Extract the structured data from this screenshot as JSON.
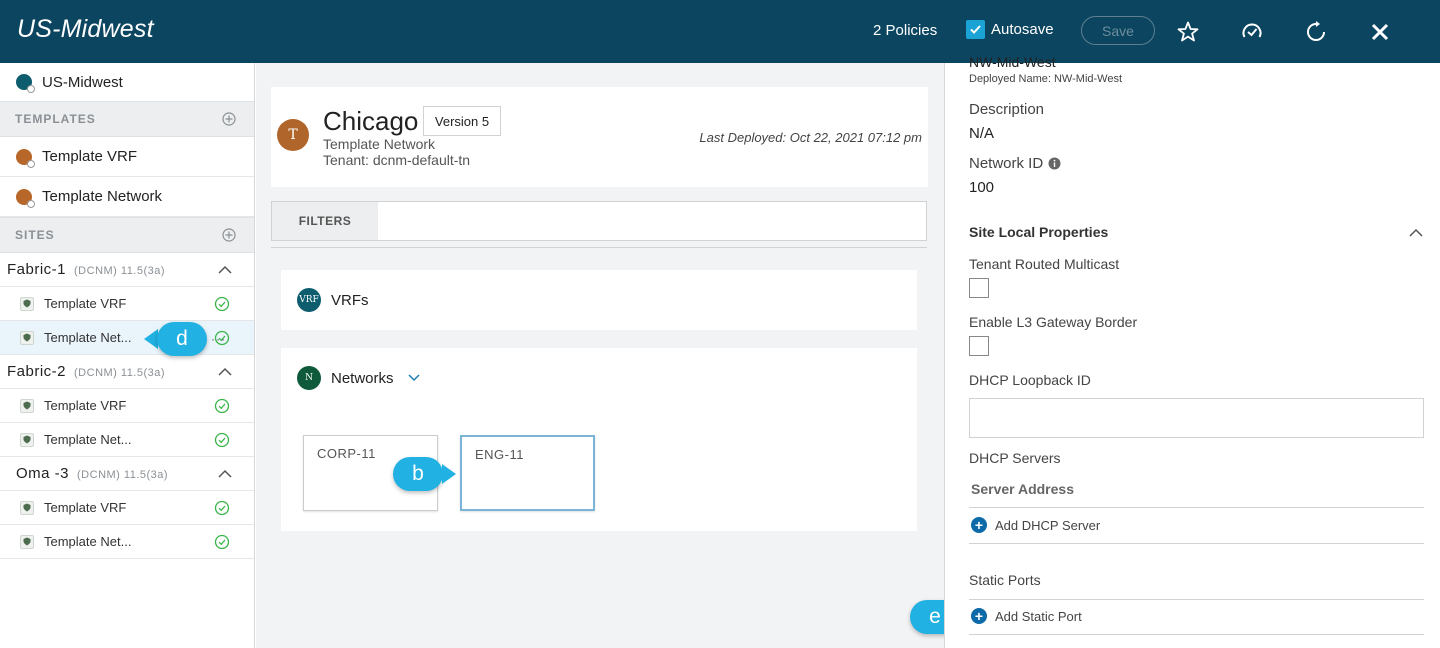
{
  "header": {
    "title": "US-Midwest",
    "policies": "2 Policies",
    "autosave_label": "Autosave",
    "save_label": "Save"
  },
  "sidebar": {
    "top_item": "US-Midwest",
    "templates_header": "TEMPLATES",
    "templates": [
      "Template VRF",
      "Template Network"
    ],
    "sites_header": "SITES",
    "fabrics": [
      {
        "name": "Fabric-1",
        "meta": "(DCNM)  11.5(3a)",
        "items": [
          "Template VRF",
          "Template Net..."
        ]
      },
      {
        "name": "Fabric-2",
        "meta": "(DCNM)  11.5(3a)",
        "items": [
          "Template VRF",
          "Template Net..."
        ]
      },
      {
        "name": "Oma -3",
        "meta": "(DCNM)  11.5(3a)",
        "items": [
          "Template VRF",
          "Template Net..."
        ]
      }
    ]
  },
  "main": {
    "avatar_letter": "T",
    "title": "Chicago",
    "version": "Version 5",
    "subtitle": "Template Network",
    "tenant": "Tenant: dcnm-default-tn",
    "last_deployed": "Last Deployed: Oct 22, 2021 07:12 pm",
    "filters_label": "FILTERS",
    "vrfs_badge": "VRF",
    "vrfs_label": "VRFs",
    "networks_badge": "N",
    "networks_label": "Networks",
    "network_tiles": [
      "CORP-11",
      "ENG-11"
    ]
  },
  "callouts": {
    "d": "d",
    "b": "b",
    "e": "e"
  },
  "right_panel": {
    "name_cut": "NW-Mid-West",
    "deployed_name": "Deployed Name: NW-Mid-West",
    "description_label": "Description",
    "description_value": "N/A",
    "network_id_label": "Network ID",
    "network_id_value": "100",
    "site_local_header": "Site Local Properties",
    "tenant_routed_multicast": "Tenant Routed Multicast",
    "enable_l3_gateway_border": "Enable L3 Gateway Border",
    "dhcp_loopback_id": "DHCP Loopback ID",
    "dhcp_servers": "DHCP Servers",
    "server_address": "Server Address",
    "add_dhcp_server": "Add DHCP Server",
    "static_ports": "Static Ports",
    "add_static_port": "Add Static Port"
  },
  "colors": {
    "header_bg": "#0b4560",
    "accent": "#21b1e3",
    "success": "#3bb54a"
  }
}
